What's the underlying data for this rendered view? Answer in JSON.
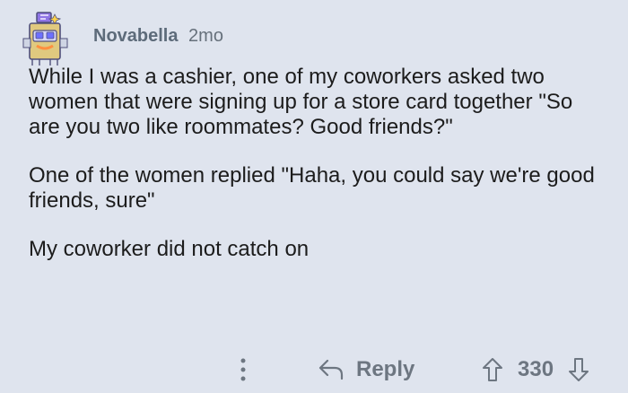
{
  "comment": {
    "username": "Novabella",
    "age": "2mo",
    "paragraphs": [
      "While I was a cashier, one of my coworkers asked two women that were signing up for a store card together \"So are you two like roommates? Good friends?\"",
      "One of the women replied \"Haha, you could say we're good friends, sure\"",
      "My coworker did not catch on"
    ]
  },
  "actions": {
    "more_icon": "three-dots-vertical",
    "reply_icon": "reply-arrow",
    "reply_label": "Reply",
    "upvote_icon": "arrow-up-outline",
    "downvote_icon": "arrow-down-outline",
    "score": "330"
  },
  "colors": {
    "background": "#dfe4ee",
    "text": "#1c1c1c",
    "meta": "#5d6b7a",
    "actions": "#6d7681"
  }
}
